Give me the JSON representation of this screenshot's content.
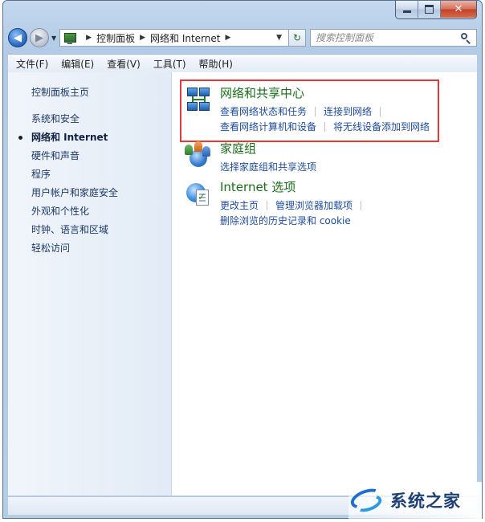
{
  "window": {
    "address": {
      "crumbs": [
        "控制面板",
        "网络和 Internet"
      ],
      "search_placeholder": "搜索控制面板"
    },
    "menu": [
      "文件(F)",
      "编辑(E)",
      "查看(V)",
      "工具(T)",
      "帮助(H)"
    ]
  },
  "sidebar": {
    "home": "控制面板主页",
    "items": [
      "系统和安全",
      "网络和 Internet",
      "硬件和声音",
      "程序",
      "用户帐户和家庭安全",
      "外观和个性化",
      "时钟、语言和区域",
      "轻松访问"
    ],
    "current_index": 1
  },
  "categories": [
    {
      "title": "网络和共享中心",
      "icon": "network-sharing-icon",
      "task_lines": [
        [
          "查看网络状态和任务",
          "连接到网络"
        ],
        [
          "查看网络计算机和设备",
          "将无线设备添加到网络"
        ]
      ]
    },
    {
      "title": "家庭组",
      "icon": "homegroup-icon",
      "task_lines": [
        [
          "选择家庭组和共享选项"
        ]
      ]
    },
    {
      "title": "Internet 选项",
      "icon": "internet-options-icon",
      "task_lines": [
        [
          "更改主页",
          "管理浏览器加载项"
        ],
        [
          "删除浏览的历史记录和 cookie"
        ]
      ]
    }
  ],
  "watermark": {
    "text": "系统之家"
  },
  "colors": {
    "highlight": "#e03a3a",
    "link": "#1e4c9c",
    "category_title": "#1a6d1a"
  }
}
